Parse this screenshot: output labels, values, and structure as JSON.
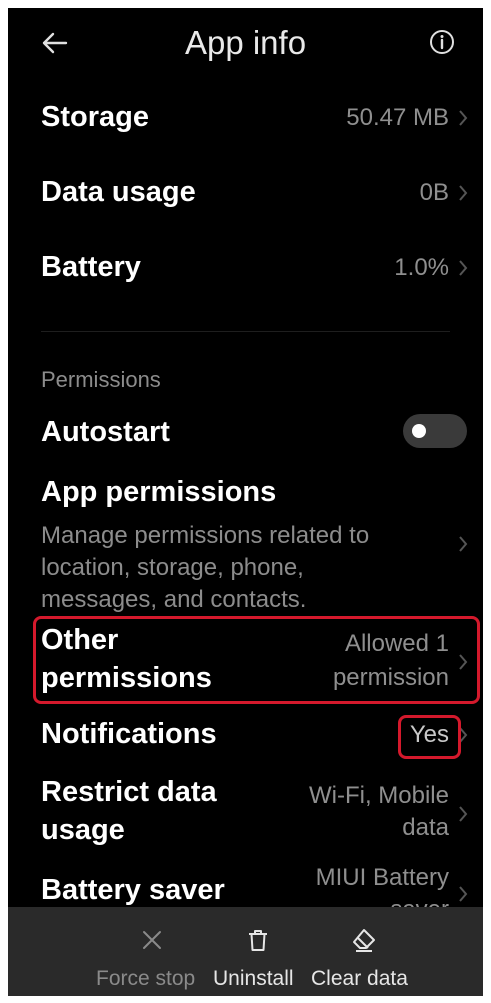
{
  "header": {
    "title": "App info",
    "back_icon": "back-arrow-icon",
    "info_icon": "info-icon"
  },
  "items": {
    "storage": {
      "label": "Storage",
      "value": "50.47 MB"
    },
    "data_usage": {
      "label": "Data usage",
      "value": "0B"
    },
    "battery": {
      "label": "Battery",
      "value": "1.0%"
    }
  },
  "permissions": {
    "section_label": "Permissions",
    "autostart": {
      "label": "Autostart",
      "enabled": false
    },
    "app_permissions": {
      "label": "App permissions",
      "description": "Manage permissions related to location, storage, phone, messages, and contacts."
    },
    "other_permissions": {
      "label_line1": "Other",
      "label_line2": "permissions",
      "value_line1": "Allowed 1",
      "value_line2": "permission"
    },
    "notifications": {
      "label": "Notifications",
      "value": "Yes"
    },
    "restrict_data": {
      "label_line1": "Restrict data",
      "label_line2": "usage",
      "value_line1": "Wi-Fi, Mobile",
      "value_line2": "data"
    },
    "battery_saver": {
      "label": "Battery saver",
      "value_line1": "MIUI Battery",
      "value_line2": "saver"
    }
  },
  "bottom_bar": {
    "force_stop": {
      "label": "Force stop",
      "icon": "close-icon"
    },
    "uninstall": {
      "label": "Uninstall",
      "icon": "trash-icon"
    },
    "clear_data": {
      "label": "Clear data",
      "icon": "eraser-icon"
    }
  },
  "colors": {
    "background": "#000000",
    "secondary_text": "#8f8f8f",
    "highlight": "#d4192c",
    "bottom_bar": "#2a2a2a"
  }
}
